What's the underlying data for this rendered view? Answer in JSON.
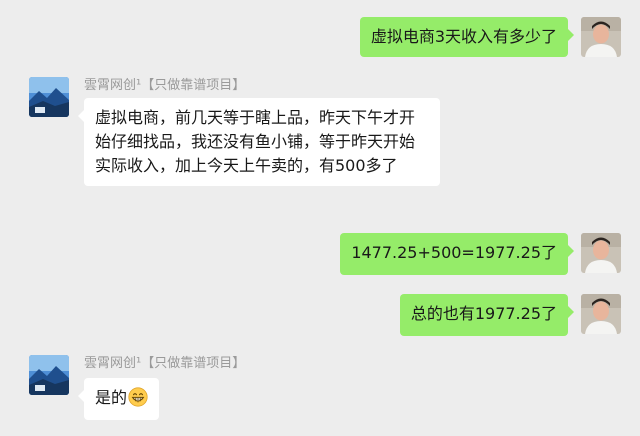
{
  "chat": {
    "messages": [
      {
        "from": "self",
        "text": "虚拟电商3天收入有多少了"
      },
      {
        "from": "other",
        "sender": "雲霄网创¹【只做靠谱项目】",
        "text": "虚拟电商，前几天等于瞎上品，昨天下午才开始仔细找品，我还没有鱼小铺，等于昨天开始实际收入，加上今天上午卖的，有500多了"
      },
      {
        "from": "self",
        "text": "1477.25+500=1977.25了"
      },
      {
        "from": "self",
        "text": "总的也有1977.25了"
      },
      {
        "from": "other",
        "sender": "雲霄网创¹【只做靠谱项目】",
        "text": "是的",
        "emoji": "grinning-face-emoji"
      }
    ]
  },
  "colors": {
    "background": "#ededed",
    "self_bubble": "#95ec69",
    "other_bubble": "#ffffff",
    "sender_name": "#9a9a9a"
  }
}
